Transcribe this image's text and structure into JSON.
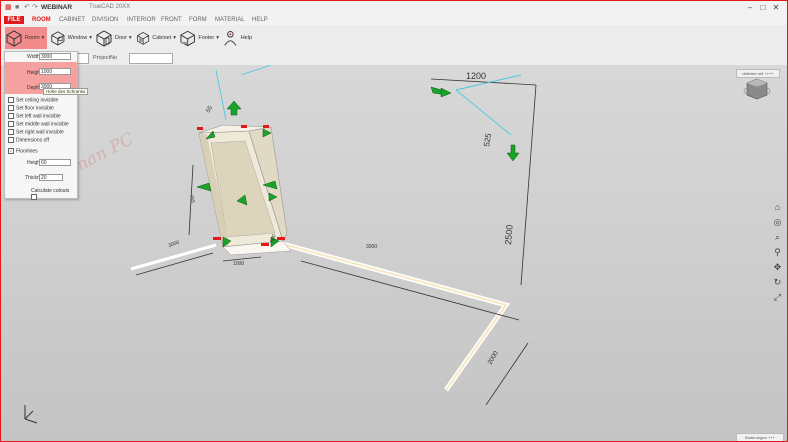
{
  "app": {
    "name": "WEBINAR",
    "document_title": "TrueCAD 20XX",
    "window_controls": [
      "–",
      "□",
      "✕"
    ]
  },
  "menu": {
    "file": "FILE",
    "items": [
      "ROOM",
      "CABINET",
      "DIVISION",
      "INTERIOR",
      "FRONT",
      "FORM",
      "MATERIAL",
      "HELP"
    ]
  },
  "ribbon": {
    "buttons": [
      {
        "label": "Room",
        "icon": "room-icon"
      },
      {
        "label": "Window",
        "icon": "window-icon"
      },
      {
        "label": "Door",
        "icon": "door-icon"
      },
      {
        "label": "Cabinet",
        "icon": "cabinet-icon"
      },
      {
        "label": "Footer",
        "icon": "footer-icon"
      },
      {
        "label": "Help",
        "icon": "help-person-icon"
      }
    ]
  },
  "toolbar2": {
    "project_label": "ProjectNo"
  },
  "room_panel": {
    "width_label": "Width",
    "width_value": "3000",
    "height_label": "Height",
    "height_value": "1000",
    "depth_label": "Depth",
    "depth_value": "3000",
    "tooltip": "Höhe des Schranks",
    "options": [
      {
        "label": "Set ceiling invisible",
        "checked": false
      },
      {
        "label": "Set floor invisible",
        "checked": false
      },
      {
        "label": "Set left wall invisible",
        "checked": false
      },
      {
        "label": "Set middle wall invisible",
        "checked": false
      },
      {
        "label": "Set right wall invisible",
        "checked": false
      },
      {
        "label": "Dimensions off",
        "checked": false
      },
      {
        "label": "Floorlines",
        "checked": true
      }
    ],
    "floor_height_label": "Height",
    "floor_height_value": "60",
    "thickness_label": "Thickness",
    "thickness_value": "20",
    "calculate_label": "Calculate cutouts"
  },
  "viewport": {
    "watermark": "Tauman PC",
    "top_right_label": "definiert mit ++++",
    "bottom_right_label": "Änderungen +++",
    "dimensions": {
      "top_width": "1200",
      "height_main": "2500",
      "right_floor": "2000",
      "floor_back": "3000",
      "floor_left": "3000",
      "cabinet_width": "1000",
      "cabinet_side": "500",
      "left_top": "455",
      "top_left": "55",
      "window_depth": "525"
    },
    "nav_icons": [
      "home-icon",
      "walk-icon",
      "zoom-fit-icon",
      "zoom-icon",
      "pan-icon",
      "rotate-icon",
      "fullscreen-icon"
    ],
    "accent": "#e01a1a",
    "arrow_green": "#1aa32a"
  }
}
